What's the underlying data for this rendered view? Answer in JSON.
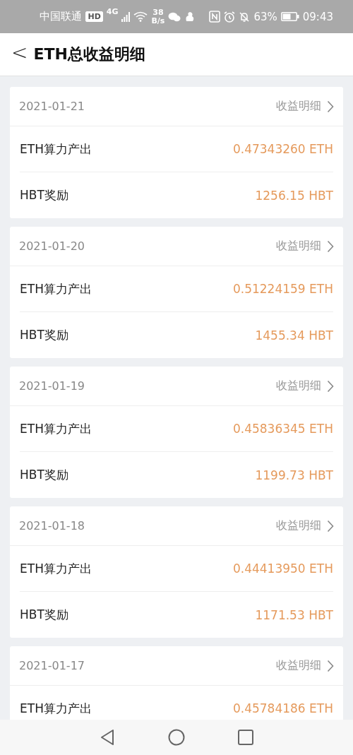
{
  "status_bar": {
    "carrier": "中国联通",
    "hd": "HD",
    "network": "4G",
    "speed_value": "38",
    "speed_unit": "B/s",
    "battery_percent": "63%",
    "time": "09:43"
  },
  "header": {
    "back": "<",
    "title": "ETH总收益明细"
  },
  "cards": [
    {
      "date": "2021-01-21",
      "link": "收益明细",
      "rows": [
        {
          "label": "ETH算力产出",
          "value": "0.47343260 ETH"
        },
        {
          "label": "HBT奖励",
          "value": "1256.15 HBT"
        }
      ]
    },
    {
      "date": "2021-01-20",
      "link": "收益明细",
      "rows": [
        {
          "label": "ETH算力产出",
          "value": "0.51224159 ETH"
        },
        {
          "label": "HBT奖励",
          "value": "1455.34 HBT"
        }
      ]
    },
    {
      "date": "2021-01-19",
      "link": "收益明细",
      "rows": [
        {
          "label": "ETH算力产出",
          "value": "0.45836345 ETH"
        },
        {
          "label": "HBT奖励",
          "value": "1199.73 HBT"
        }
      ]
    },
    {
      "date": "2021-01-18",
      "link": "收益明细",
      "rows": [
        {
          "label": "ETH算力产出",
          "value": "0.44413950 ETH"
        },
        {
          "label": "HBT奖励",
          "value": "1171.53 HBT"
        }
      ]
    },
    {
      "date": "2021-01-17",
      "link": "收益明细",
      "rows": [
        {
          "label": "ETH算力产出",
          "value": "0.45784186 ETH"
        }
      ]
    }
  ]
}
